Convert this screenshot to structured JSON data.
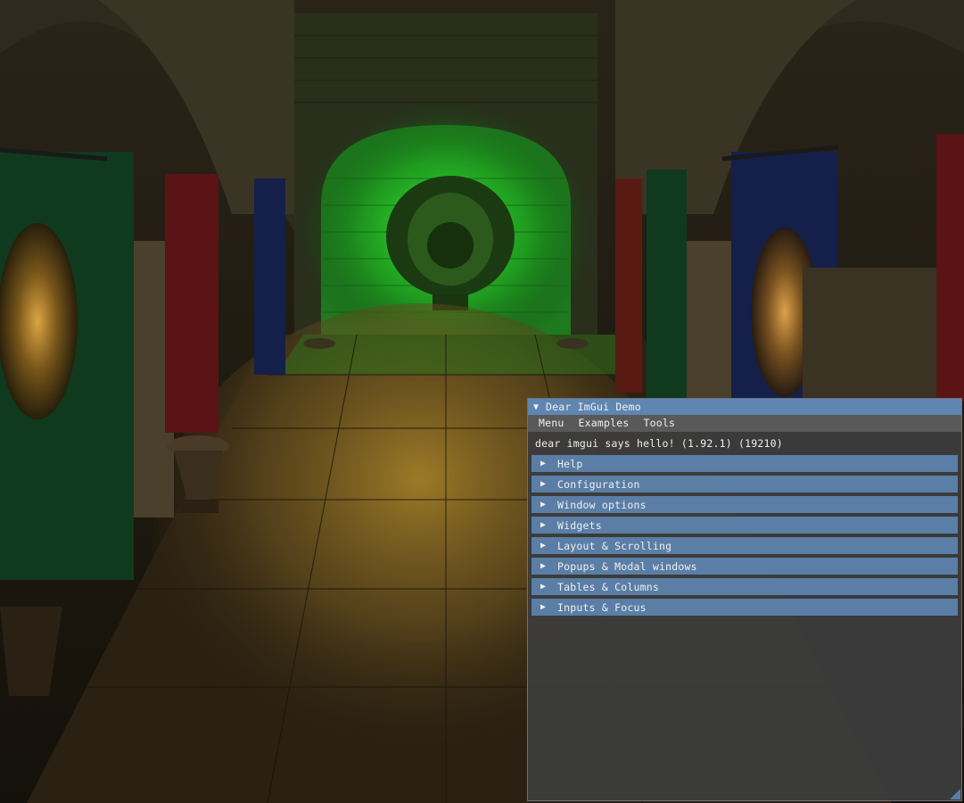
{
  "window": {
    "title": "Dear ImGui Demo",
    "collapse_icon": "triangle-down-icon"
  },
  "menubar": {
    "items": [
      "Menu",
      "Examples",
      "Tools"
    ]
  },
  "greeting": "dear imgui says hello! (1.92.1) (19210)",
  "sections": [
    {
      "label": "Help"
    },
    {
      "label": "Configuration"
    },
    {
      "label": "Window options"
    },
    {
      "label": "Widgets"
    },
    {
      "label": "Layout & Scrolling"
    },
    {
      "label": "Popups & Modal windows"
    },
    {
      "label": "Tables & Columns"
    },
    {
      "label": "Inputs & Focus"
    }
  ],
  "colors": {
    "title_bg": "#5f86b0",
    "header_bg": "#5a7ea6",
    "window_bg": "#3c3c3c",
    "menubar_bg": "#595959"
  }
}
